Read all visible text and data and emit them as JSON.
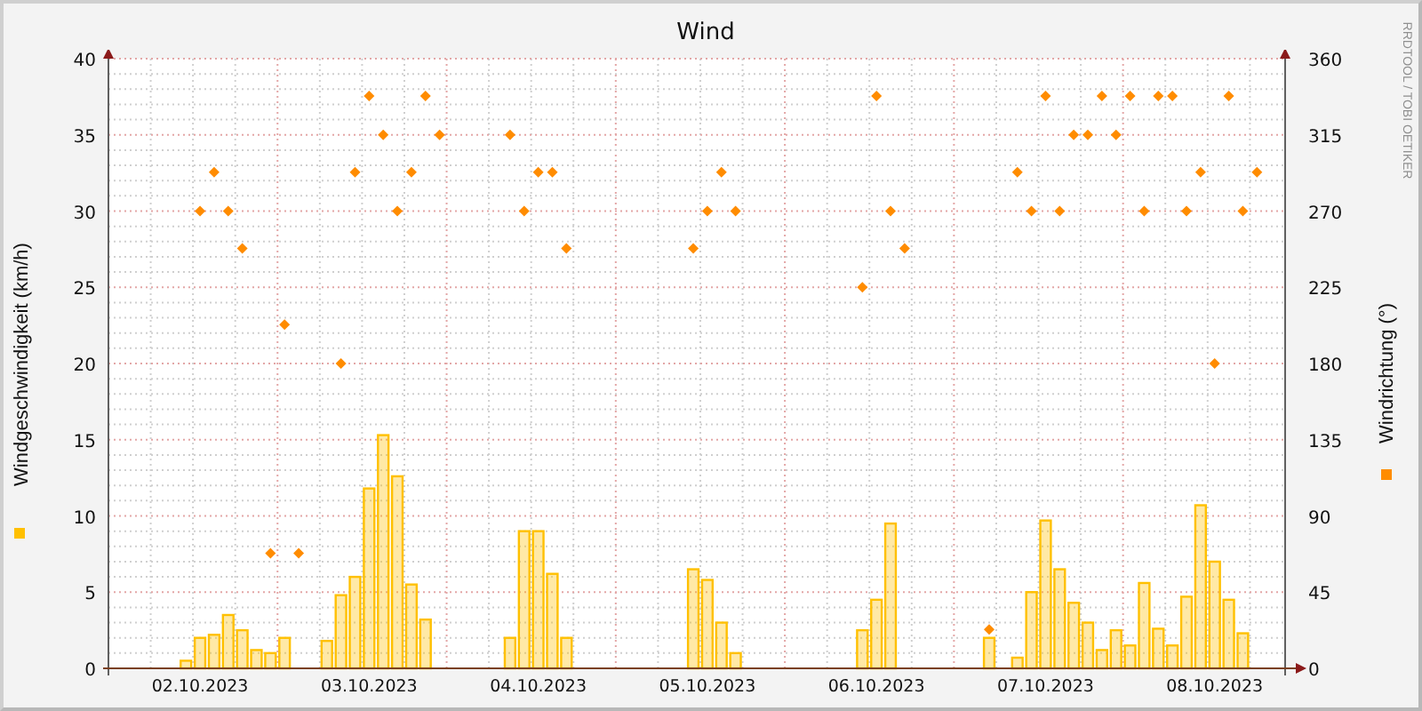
{
  "credit": "RRDTOOL / TOBI OETIKER",
  "chart_data": {
    "type": "bar",
    "title": "Wind",
    "grid": true,
    "ylim": [
      0,
      40
    ],
    "y2lim": [
      0,
      360
    ],
    "yticks": [
      0,
      5,
      10,
      15,
      20,
      25,
      30,
      35,
      40
    ],
    "y2ticks": [
      0,
      45,
      90,
      135,
      180,
      225,
      270,
      315,
      360
    ],
    "categories": [
      null,
      null,
      null,
      null,
      null,
      null,
      "02.10.2023",
      null,
      null,
      null,
      null,
      null,
      null,
      null,
      null,
      null,
      null,
      null,
      "03.10.2023",
      null,
      null,
      null,
      null,
      null,
      null,
      null,
      null,
      null,
      null,
      null,
      "04.10.2023",
      null,
      null,
      null,
      null,
      null,
      null,
      null,
      null,
      null,
      null,
      null,
      "05.10.2023",
      null,
      null,
      null,
      null,
      null,
      null,
      null,
      null,
      null,
      null,
      null,
      "06.10.2023",
      null,
      null,
      null,
      null,
      null,
      null,
      null,
      null,
      null,
      null,
      null,
      "07.10.2023",
      null,
      null,
      null,
      null,
      null,
      null,
      null,
      null,
      null,
      null,
      null,
      "08.10.2023",
      null,
      null,
      null,
      null
    ],
    "series": [
      {
        "name": "Windgeschwindigkeit (km/h)",
        "color": "#ffc000",
        "values": [
          0,
          0,
          0,
          0,
          0,
          0.5,
          2,
          2.2,
          3.5,
          2.5,
          1.2,
          1,
          2,
          0,
          0,
          1.8,
          4.8,
          6,
          11.8,
          15.3,
          12.6,
          5.5,
          3.2,
          0,
          0,
          0,
          0,
          0,
          2,
          9,
          9,
          6.2,
          2,
          0,
          0,
          0,
          0,
          0,
          0,
          0,
          0,
          6.5,
          5.8,
          3,
          1,
          0,
          0,
          0,
          0,
          0,
          0,
          0,
          0,
          2.5,
          4.5,
          9.5,
          0,
          0,
          0,
          0,
          0,
          0,
          2,
          0,
          0.7,
          5,
          9.7,
          6.5,
          4.3,
          3,
          1.2,
          2.5,
          1.5,
          5.6,
          2.6,
          1.5,
          4.7,
          10.7,
          7,
          4.5,
          2.3,
          0,
          0
        ]
      },
      {
        "name": "Windrichtung (°)",
        "axis": "y2",
        "type": "scatter",
        "color": "#ff8c00",
        "values": [
          null,
          null,
          null,
          null,
          null,
          null,
          270,
          293,
          270,
          248,
          null,
          68,
          203,
          68,
          null,
          null,
          180,
          293,
          338,
          315,
          270,
          293,
          338,
          315,
          null,
          null,
          null,
          null,
          315,
          270,
          293,
          293,
          248,
          null,
          null,
          null,
          null,
          null,
          null,
          null,
          null,
          248,
          270,
          293,
          270,
          null,
          null,
          null,
          null,
          null,
          null,
          null,
          null,
          225,
          338,
          270,
          248,
          null,
          null,
          null,
          null,
          null,
          23,
          null,
          293,
          270,
          338,
          270,
          315,
          315,
          338,
          315,
          338,
          270,
          338,
          338,
          270,
          293,
          180,
          338,
          270,
          293,
          null
        ]
      }
    ]
  }
}
